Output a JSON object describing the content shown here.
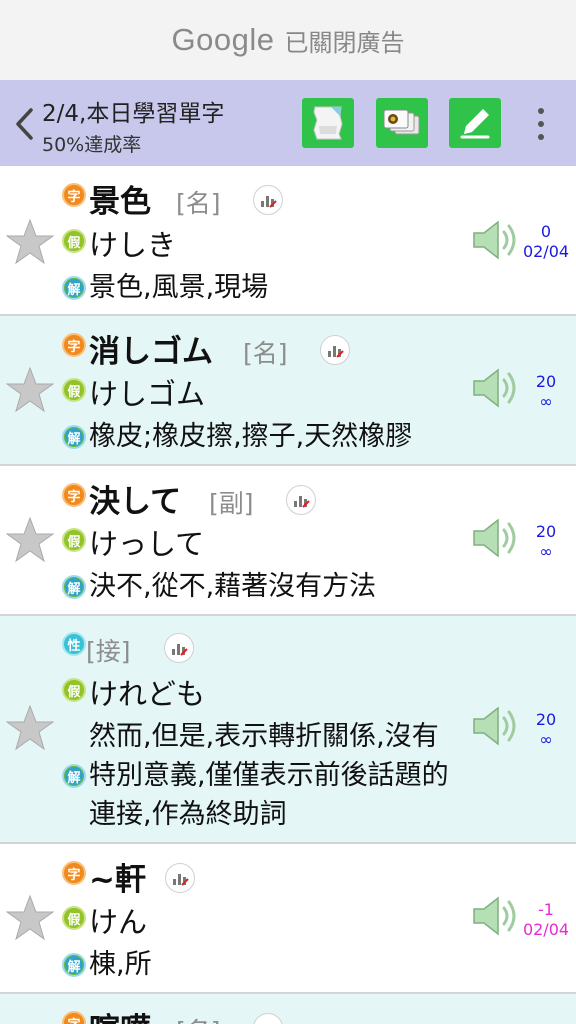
{
  "ad": {
    "brand": "Google",
    "text": "已關閉廣告"
  },
  "toolbar": {
    "title": "2/4,本日學習單字",
    "subtitle": "50%達成率"
  },
  "entries": [
    {
      "word": "景色",
      "pos": "[名]",
      "reading": "けしき",
      "meaning": "景色,風景,現場",
      "count": "0",
      "date": "02/04"
    },
    {
      "word": "消しゴム",
      "pos": "[名]",
      "reading": "けしゴム",
      "meaning": "橡皮;橡皮擦,擦子,天然橡膠",
      "count": "20",
      "date": "∞"
    },
    {
      "word": "決して",
      "pos": "[副]",
      "reading": "けっして",
      "meaning": "決不,從不,藉著沒有方法",
      "count": "20",
      "date": "∞"
    },
    {
      "word": "",
      "pos": "[接]",
      "reading": "けれども",
      "meaning_lines": [
        "然而,但是,表示轉折關係,沒有",
        "特別意義,僅僅表示前後話題的",
        "連接,作為終助詞"
      ],
      "count": "20",
      "date": "∞"
    },
    {
      "word": "~軒",
      "pos": "",
      "reading": "けん",
      "meaning": "棟,所",
      "count": "-1",
      "date": "02/04"
    },
    {
      "word": "喧嘩",
      "pos": "[名]"
    }
  ],
  "badges": {
    "word": "字",
    "reading": "假",
    "meaning": "解",
    "pos_type": "性"
  },
  "colors": {
    "toolbar_bg": "#c8c8ec",
    "alt_row_bg": "#e5f6f7",
    "action_green": "#2fc34a",
    "count_blue": "#1a1ae0",
    "count_magenta": "#e82ad4"
  }
}
